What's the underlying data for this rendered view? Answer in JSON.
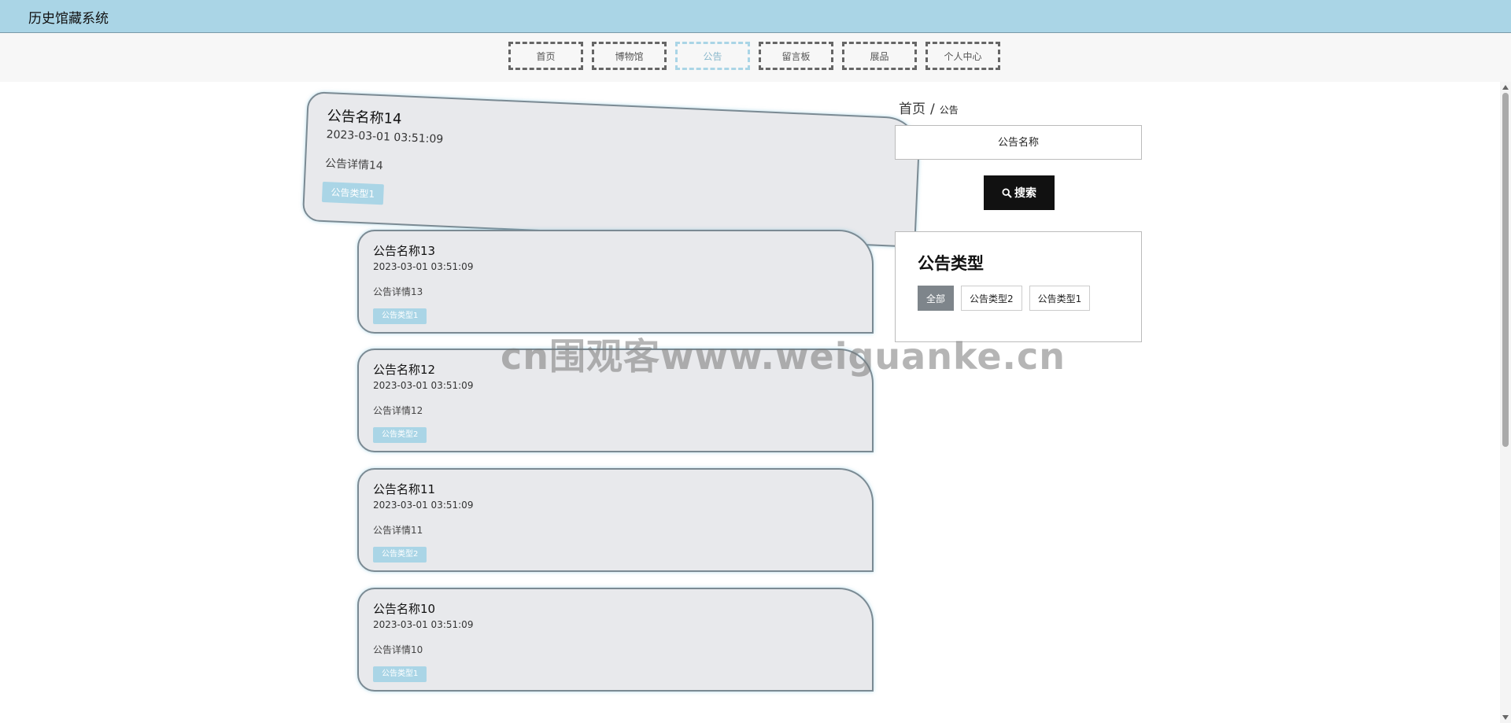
{
  "app": {
    "title": "历史馆藏系统"
  },
  "nav": {
    "items": [
      {
        "label": "首页"
      },
      {
        "label": "博物馆"
      },
      {
        "label": "公告"
      },
      {
        "label": "留言板"
      },
      {
        "label": "展品"
      },
      {
        "label": "个人中心"
      }
    ],
    "active_index": 2
  },
  "breadcrumb": {
    "home": "首页",
    "separator": "/",
    "current": "公告"
  },
  "search": {
    "placeholder": "公告名称",
    "button_label": "搜索",
    "icon": "search-icon"
  },
  "types": {
    "title": "公告类型",
    "items": [
      {
        "label": "全部",
        "active": true
      },
      {
        "label": "公告类型2",
        "active": false
      },
      {
        "label": "公告类型1",
        "active": false
      }
    ]
  },
  "notices": [
    {
      "title": "公告名称14",
      "time": "2023-03-01 03:51:09",
      "detail": "公告详情14",
      "type": "公告类型1"
    },
    {
      "title": "公告名称13",
      "time": "2023-03-01 03:51:09",
      "detail": "公告详情13",
      "type": "公告类型1"
    },
    {
      "title": "公告名称12",
      "time": "2023-03-01 03:51:09",
      "detail": "公告详情12",
      "type": "公告类型2"
    },
    {
      "title": "公告名称11",
      "time": "2023-03-01 03:51:09",
      "detail": "公告详情11",
      "type": "公告类型2"
    },
    {
      "title": "公告名称10",
      "time": "2023-03-01 03:51:09",
      "detail": "公告详情10",
      "type": "公告类型1"
    }
  ],
  "watermark": "cn围观客www.weiguanke.cn",
  "colors": {
    "header_bg": "#aad5e6",
    "accent": "#aad5e6",
    "card_bg": "#e8e9ec",
    "button_dark": "#111111"
  }
}
